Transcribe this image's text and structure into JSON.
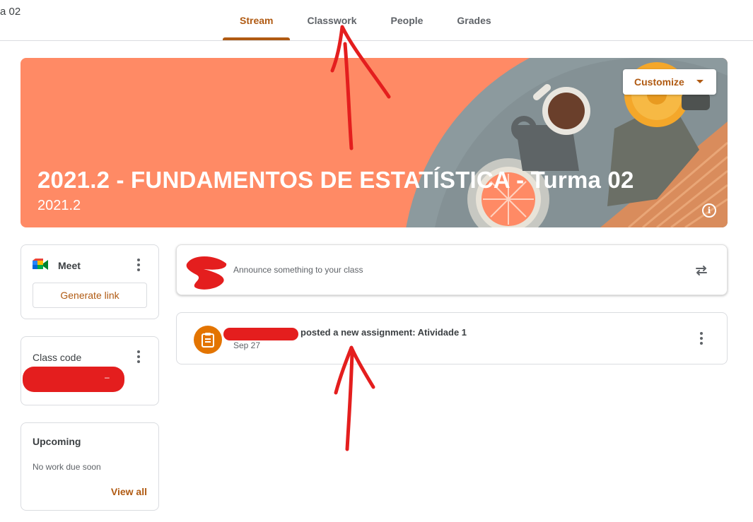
{
  "header": {
    "class_title_fragment": "a 02",
    "tabs": [
      {
        "label": "Stream",
        "active": true
      },
      {
        "label": "Classwork",
        "active": false
      },
      {
        "label": "People",
        "active": false
      },
      {
        "label": "Grades",
        "active": false
      }
    ]
  },
  "banner": {
    "title": "2021.2 - FUNDAMENTOS DE ESTATÍSTICA - Turma 02",
    "subtitle": "2021.2",
    "customize_label": "Customize",
    "info_icon": "info-icon",
    "background_color": "#ff8a65"
  },
  "sidebar": {
    "meet": {
      "title": "Meet",
      "button_label": "Generate link",
      "icon": "google-meet-icon"
    },
    "class_code": {
      "title": "Class code",
      "redacted_suffix": "–"
    },
    "upcoming": {
      "title": "Upcoming",
      "status": "No work due soon",
      "link_label": "View all"
    }
  },
  "stream": {
    "announce_placeholder": "Announce something to your class",
    "repost_icon": "repost-icon",
    "posts": [
      {
        "text": "posted a new assignment: Atividade 1",
        "date": "Sep 27",
        "icon": "assignment-icon"
      }
    ]
  },
  "colors": {
    "accent": "#b05a12",
    "banner": "#ff8a65",
    "assignment": "#e37400",
    "annotation_red": "#e41e1e"
  }
}
